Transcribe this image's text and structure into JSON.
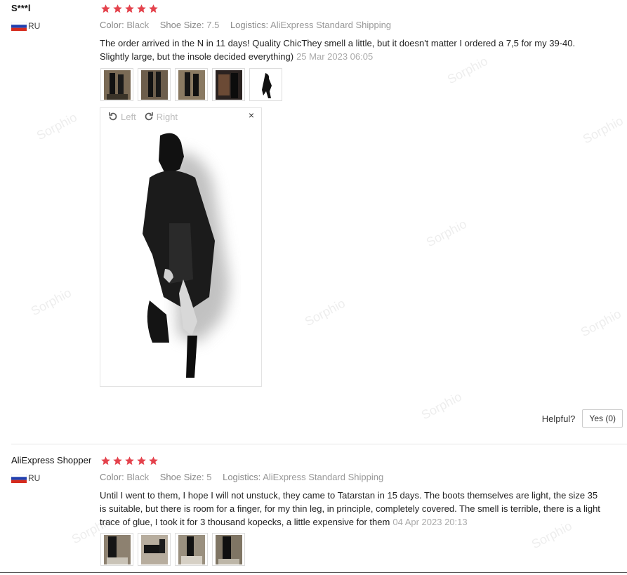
{
  "colors": {
    "star": "#e4424c",
    "accent": "#e4424c"
  },
  "watermark_text": "Sorphio",
  "reviews": [
    {
      "user": "S***l",
      "country": "RU",
      "rating": 5,
      "color_label": "Color:",
      "color_value": "Black",
      "size_label": "Shoe Size:",
      "size_value": "7.5",
      "logistics_label": "Logistics:",
      "logistics_value": "AliExpress Standard Shipping",
      "text": "The order arrived in the N in 11 days! Quality ChicThey smell a little, but it doesn't matter I ordered a 7,5 for my 39-40. Slightly large, but the insole decided everything)",
      "date": "25 Mar 2023 06:05",
      "viewer": {
        "rotate_left": "Left",
        "rotate_right": "Right",
        "close": "×"
      },
      "helpful_label": "Helpful?",
      "yes_label": "Yes (0)"
    },
    {
      "user": "AliExpress Shopper",
      "country": "RU",
      "rating": 5,
      "color_label": "Color:",
      "color_value": "Black",
      "size_label": "Shoe Size:",
      "size_value": "5",
      "logistics_label": "Logistics:",
      "logistics_value": "AliExpress Standard Shipping",
      "text": "Until I went to them, I hope I will not unstuck, they came to Tatarstan in 15 days. The boots themselves are light, the size 35 is suitable, but there is room for a finger, for my thin leg, in principle, completely covered. The smell is terrible, there is a light trace of glue, I took it for 3 thousand kopecks, a little expensive for them",
      "date": "04 Apr 2023 20:13"
    }
  ]
}
